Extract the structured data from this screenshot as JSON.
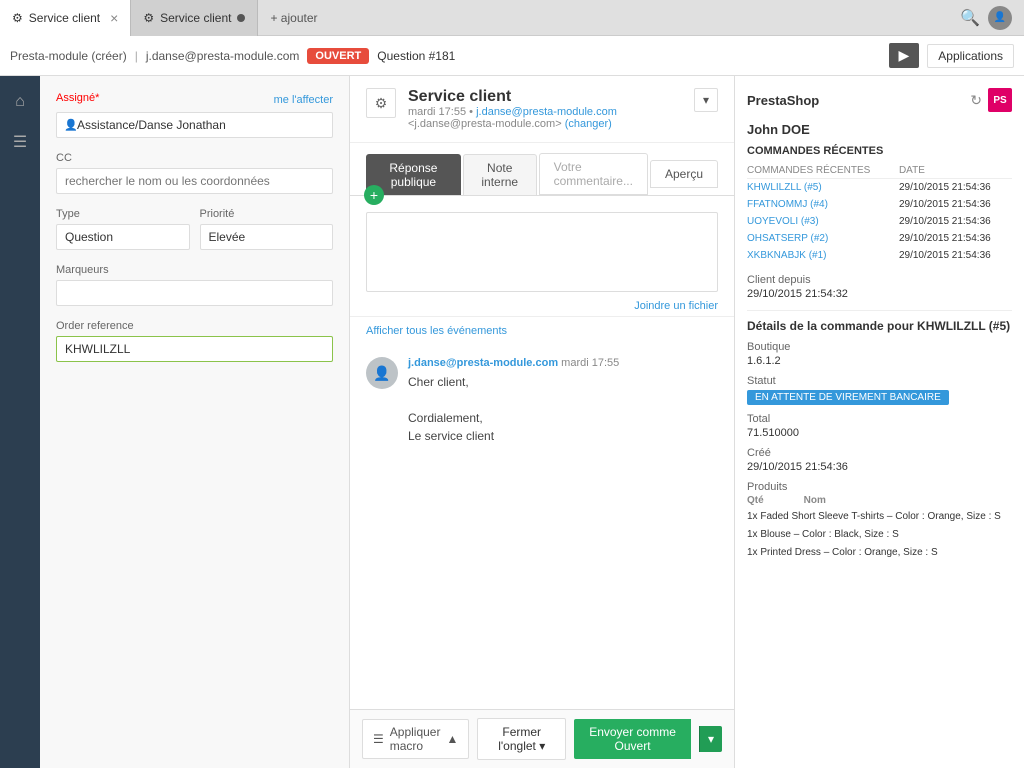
{
  "browser": {
    "tab1_icon": "⚙",
    "tab1_label": "Service client",
    "tab2_icon": "⚙",
    "tab2_label": "Service client",
    "add_tab_label": "+ ajouter",
    "search_icon": "🔍",
    "nav_arrow": "▶",
    "applications_label": "Applications"
  },
  "breadcrumb": {
    "item1": "Presta-module (créer)",
    "item2": "j.danse@presta-module.com",
    "badge": "OUVERT",
    "item3": "Question #181"
  },
  "left_panel": {
    "assignee_label": "Assigné",
    "me_link": "me l'affecter",
    "assignee_value": "Assistance/Danse Jonathan",
    "cc_label": "CC",
    "cc_placeholder": "rechercher le nom ou les coordonnées",
    "type_label": "Type",
    "type_value": "Question",
    "priority_label": "Priorité",
    "priority_value": "Elevée",
    "markers_label": "Marqueurs",
    "order_ref_label": "Order reference",
    "order_ref_value": "KHWLILZLL"
  },
  "ticket": {
    "gear_icon": "⚙",
    "title": "Service client",
    "meta_time": "mardi 17:55",
    "meta_bullet": "•",
    "meta_email": "j.danse@presta-module.com",
    "meta_email_full": "<j.danse@presta-module.com>",
    "meta_change": "(changer)",
    "dropdown_arrow": "▾"
  },
  "reply": {
    "tab_public": "Réponse publique",
    "tab_note": "Note interne",
    "tab_comment_placeholder": "Votre commentaire...",
    "tab_preview": "Aperçu",
    "add_icon": "+",
    "attach_link": "Joindre un fichier"
  },
  "events": {
    "link": "Afficher tous les événements"
  },
  "message": {
    "sender_email": "j.danse@presta-module.com",
    "sender_time": "mardi 17:55",
    "greeting": "Cher client,",
    "body1": "Cordialement,",
    "body2": "Le service client"
  },
  "bottom_bar": {
    "macro_icon": "☰",
    "macro_label": "Appliquer macro",
    "macro_arrow": "▲",
    "close_label": "Fermer l'onglet",
    "close_arrow": "▾",
    "send_label": "Envoyer comme",
    "send_status": "Ouvert",
    "send_arrow": "▾"
  },
  "right_panel": {
    "title": "PrestaShop",
    "refresh_icon": "↻",
    "ps_logo": "PS",
    "client_name": "John DOE",
    "orders_section": "COMMANDES RÉCENTES",
    "orders_date_col": "DATE",
    "orders": [
      {
        "ref": "KHWLILZLL (#5)",
        "date": "29/10/2015 21:54:36"
      },
      {
        "ref": "FFATNOMMJ (#4)",
        "date": "29/10/2015 21:54:36"
      },
      {
        "ref": "UOYEVOLI (#3)",
        "date": "29/10/2015 21:54:36"
      },
      {
        "ref": "OHSATSERP (#2)",
        "date": "29/10/2015 21:54:36"
      },
      {
        "ref": "XKBKNABJK (#1)",
        "date": "29/10/2015 21:54:36"
      }
    ],
    "client_since_label": "Client depuis",
    "client_since_value": "29/10/2015 21:54:32",
    "order_detail_title": "Détails de la commande pour KHWLILZLL (#5)",
    "boutique_label": "Boutique",
    "boutique_value": "1.6.1.2",
    "statut_label": "Statut",
    "statut_value": "EN ATTENTE DE VIREMENT BANCAIRE",
    "total_label": "Total",
    "total_value": "71.510000",
    "cree_label": "Créé",
    "cree_value": "29/10/2015 21:54:36",
    "products_label": "Produits",
    "qty_col": "Qté",
    "name_col": "Nom",
    "products": [
      {
        "qty": "1x",
        "name": "Faded Short Sleeve T-shirts – Color : Orange, Size : S"
      },
      {
        "qty": "1x",
        "name": "Blouse – Color : Black, Size : S"
      },
      {
        "qty": "1x",
        "name": "Printed Dress – Color : Orange, Size : S"
      }
    ]
  }
}
